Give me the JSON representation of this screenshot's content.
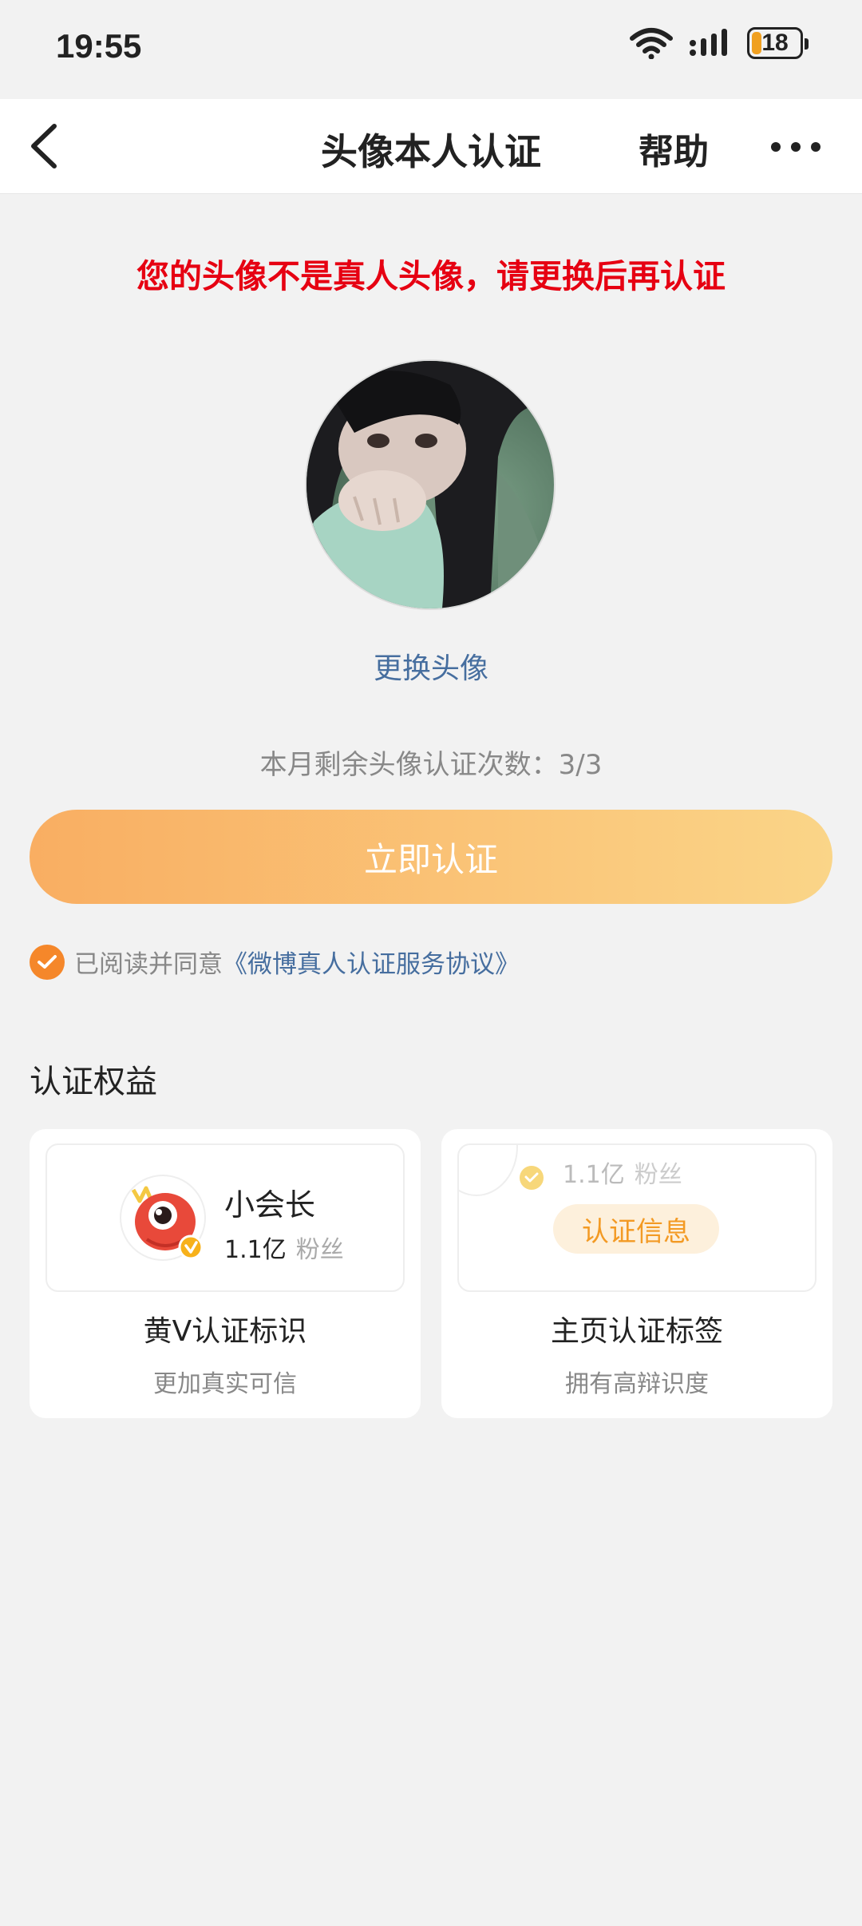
{
  "status_bar": {
    "time": "19:55",
    "battery_level": "18"
  },
  "nav": {
    "title": "头像本人认证",
    "help_label": "帮助"
  },
  "warning": "您的头像不是真人头像，请更换后再认证",
  "change_avatar_label": "更换头像",
  "remaining_text": "本月剩余头像认证次数：3/3",
  "verify_button_label": "立即认证",
  "agreement": {
    "prefix": "已阅读并同意",
    "link": "《微博真人认证服务协议》",
    "checked": true
  },
  "benefits": {
    "title": "认证权益",
    "cards": [
      {
        "preview_name": "小会长",
        "preview_fans_num": "1.1亿",
        "preview_fans_label": "粉丝",
        "name": "黄V认证标识",
        "desc": "更加真实可信"
      },
      {
        "preview_fans_num": "1.1亿",
        "preview_fans_label": "粉丝",
        "preview_tag": "认证信息",
        "name": "主页认证标签",
        "desc": "拥有高辩识度"
      }
    ]
  },
  "colors": {
    "warning": "#e60012",
    "link": "#466e9f",
    "button_gradient_start": "#f9ae62",
    "button_gradient_end": "#fad588",
    "accent": "#f5872a"
  }
}
